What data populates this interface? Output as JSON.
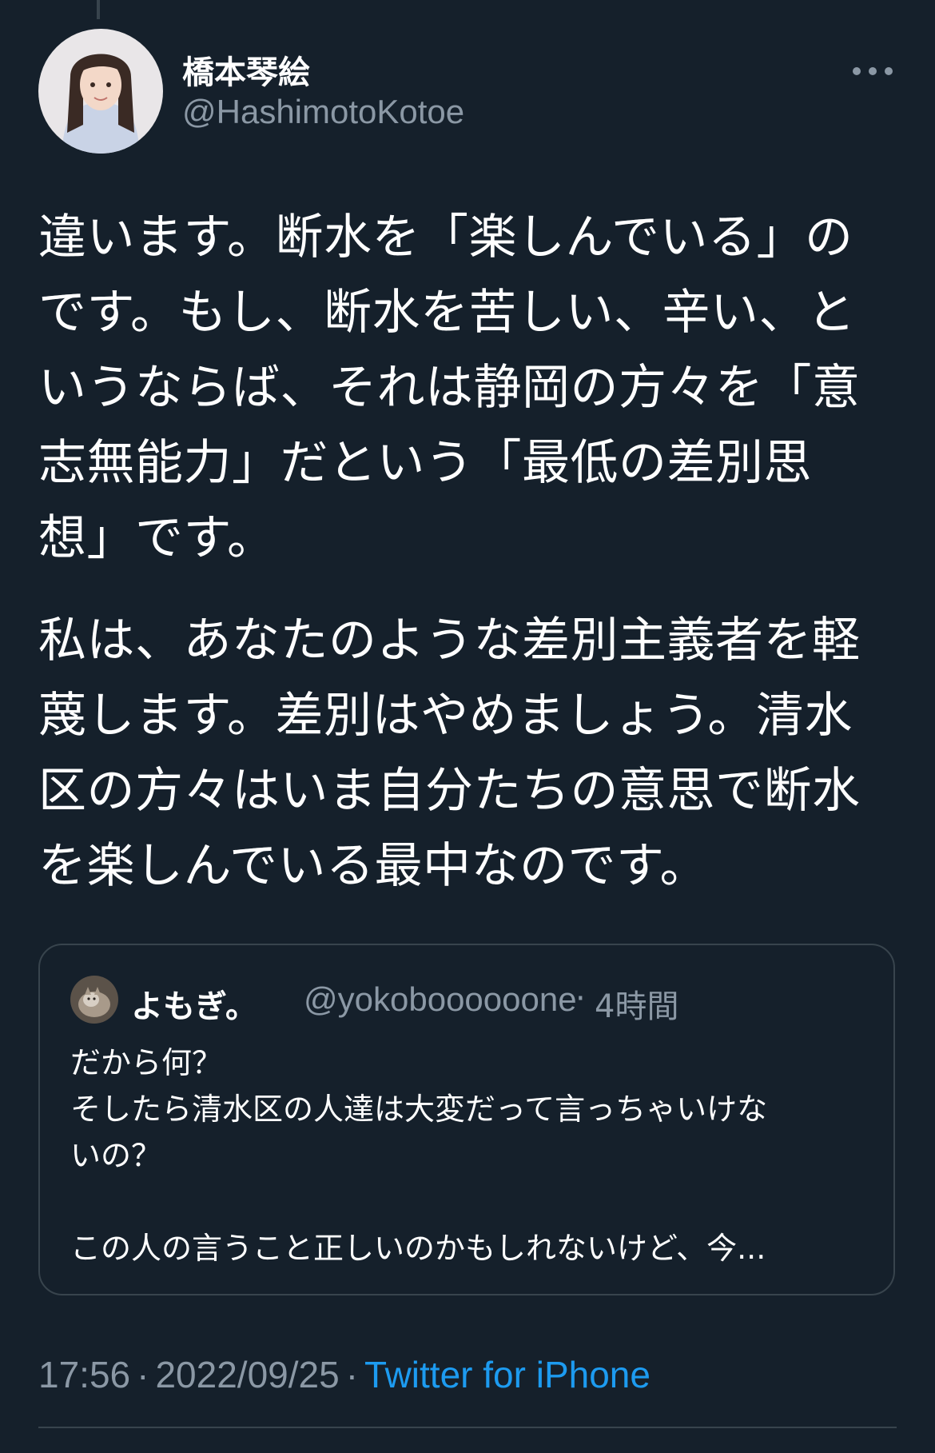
{
  "author": {
    "name": "橋本琴絵",
    "handle": "@HashimotoKotoe",
    "avatar_icon": "profile-photo"
  },
  "tweet": {
    "paragraphs": [
      "違います。断水を「楽しんでいる」の\nです。もし、断水を苦しい、辛い、と\nいうならば、それは静岡の方々を「意\n志無能力」だという「最低の差別思\n想」です。",
      "私は、あなたのような差別主義者を軽\n蔑します。差別はやめましょう。清水\n区の方々はいま自分たちの意思で断水\nを楽しんでいる最中なのです。"
    ]
  },
  "quote": {
    "author_name": "よもぎ。",
    "author_handle": "@yokoboooooone",
    "separator": "·",
    "time": "4時間",
    "text": "だから何？\nそしたら清水区の人達は大変だって言っちゃいけな\nいの？\n\nこの人の言うこと正しいのかもしれないけど、今...",
    "avatar_icon": "cat-avatar"
  },
  "meta": {
    "time": "17:56",
    "separator": "·",
    "date": "2022/09/25",
    "source": "Twitter for iPhone"
  },
  "colors": {
    "background": "#15202b",
    "text": "#ffffff",
    "secondary": "#8b98a5",
    "accent": "#1d9bf0",
    "border": "#38444d"
  },
  "icons": {
    "more": "more-horizontal-icon"
  }
}
